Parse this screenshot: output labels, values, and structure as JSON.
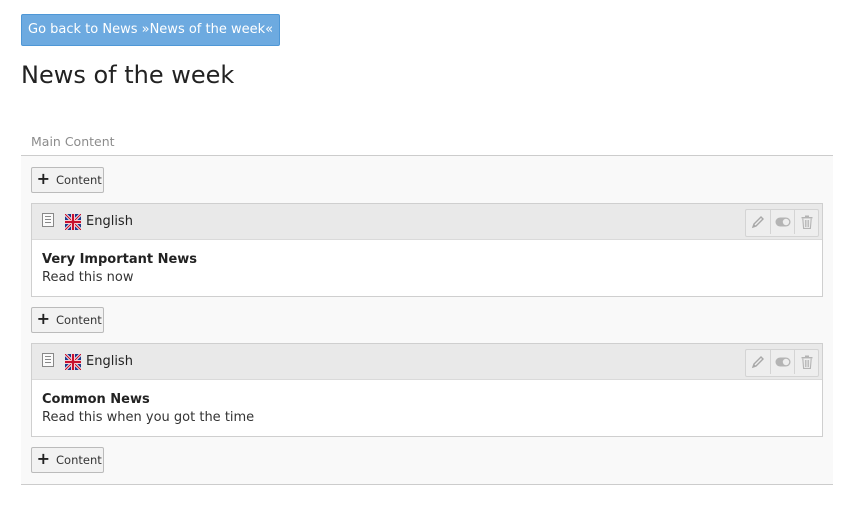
{
  "header": {
    "back_button_label": "Go back to News »News of the week«",
    "page_title": "News of the week"
  },
  "section": {
    "title": "Main Content",
    "add_content_label": "Content",
    "elements": [
      {
        "language": "English",
        "title": "Very Important News",
        "text": "Read this now"
      },
      {
        "language": "English",
        "title": "Common News",
        "text": "Read this when you got the time"
      }
    ]
  },
  "icons": {
    "element_type": "text-element-icon",
    "language_flag": "uk-flag-icon",
    "edit": "pencil-icon",
    "toggle": "toggle-visibility-icon",
    "delete": "trash-icon",
    "add": "plus-icon"
  },
  "colors": {
    "back_button": "#6daae0",
    "element_header": "#e9e9e9",
    "section_background": "#f9f9f9"
  }
}
